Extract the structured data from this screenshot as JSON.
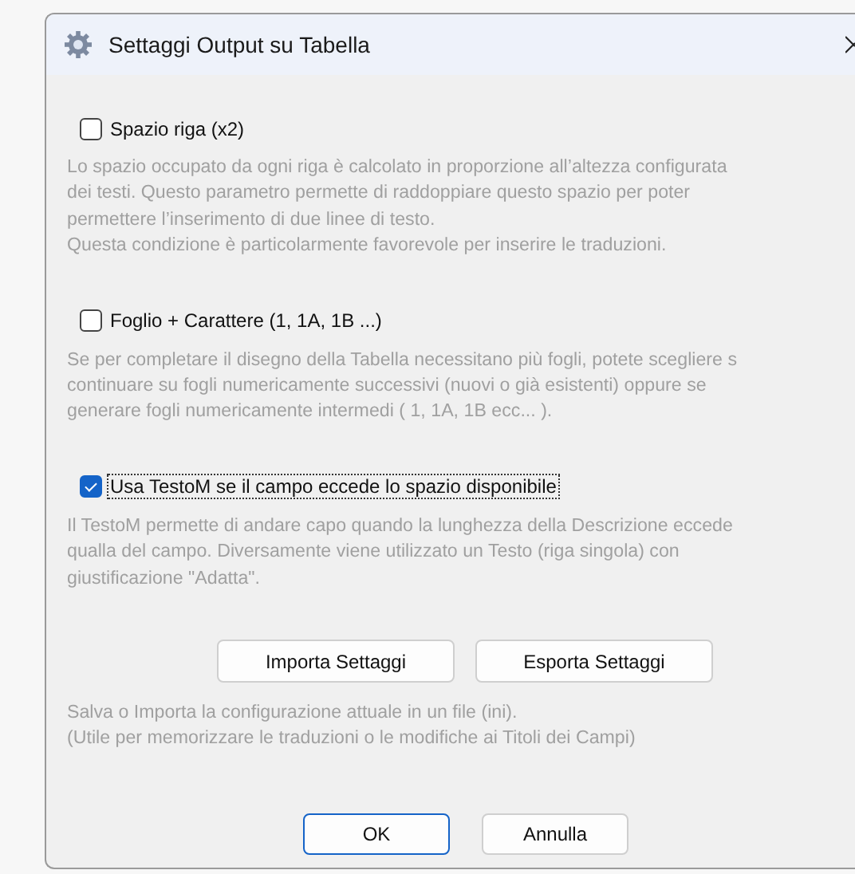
{
  "window": {
    "title": "Settaggi Output su Tabella"
  },
  "options": [
    {
      "label": "Spazio riga (x2)",
      "checked": false,
      "focused": false,
      "description": "Lo spazio occupato da ogni riga è calcolato in proporzione all’altezza configurata\ndei testi. Questo parametro permette di raddoppiare questo spazio per poter\npermettere l’inserimento di due linee di testo.\nQuesta condizione è particolarmente favorevole per inserire le traduzioni."
    },
    {
      "label": "Foglio + Carattere (1, 1A, 1B ...)",
      "checked": false,
      "focused": false,
      "description": "Se per completare il disegno della Tabella necessitano più fogli, potete scegliere s\ncontinuare su fogli numericamente successivi (nuovi o già esistenti) oppure se\ngenerare fogli numericamente intermedi ( 1, 1A, 1B ecc... )."
    },
    {
      "label": "Usa TestoM se il campo eccede lo spazio disponibile",
      "checked": true,
      "focused": true,
      "description": "Il TestoM permette di andare capo quando la lunghezza della Descrizione eccede\nqualla del campo. Diversamente viene utilizzato un Testo (riga singola) con\ngiustificazione \"Adatta\"."
    }
  ],
  "settings_buttons": [
    {
      "label": "Importa Settaggi"
    },
    {
      "label": "Esporta Settaggi"
    }
  ],
  "note": "Salva o Importa la configurazione attuale in un file (ini).\n(Utile per memorizzare le traduzioni o le modifiche ai Titoli dei Campi)",
  "dialog_buttons": [
    {
      "label": "OK",
      "default": true
    },
    {
      "label": "Annulla",
      "default": false
    }
  ]
}
